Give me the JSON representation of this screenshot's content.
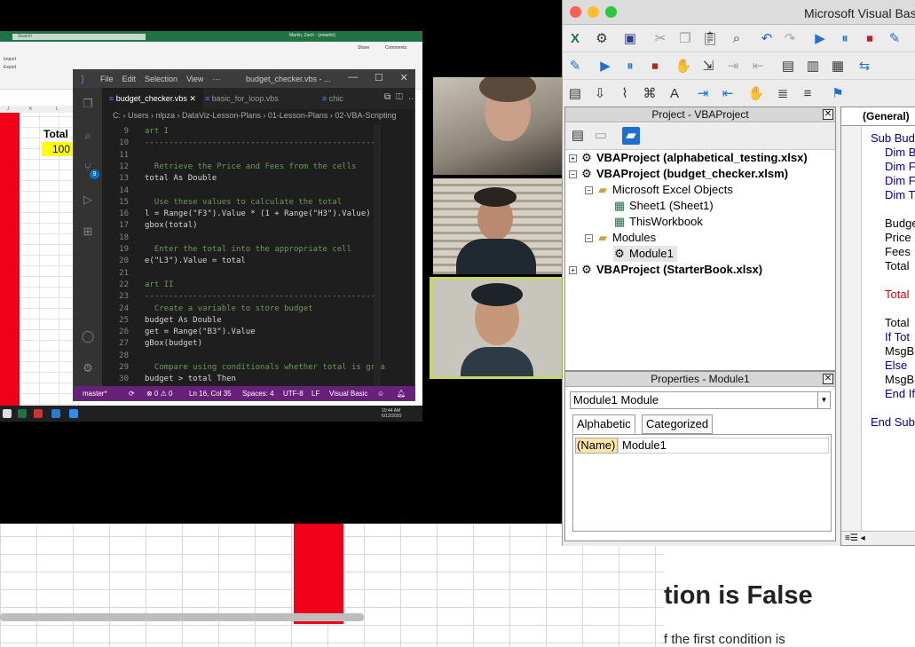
{
  "doc": {
    "heading": "tion is False",
    "line": "f the first condition is"
  },
  "share": {
    "search_placeholder": "Search",
    "user": "Martin, Zach · (zmartin)",
    "share_label": "Share",
    "comments_label": "Comments",
    "import_label": "Import",
    "export_label": "Export",
    "col_j": "J",
    "col_k": "K",
    "col_l": "L",
    "total_label": "Total",
    "total_value": "100",
    "clock_time": "10:44 AM",
    "clock_date": "6/12/2020"
  },
  "vscode": {
    "menu": [
      "File",
      "Edit",
      "Selection",
      "View",
      "···"
    ],
    "window_title": "budget_checker.vbs - ...",
    "tabs": [
      "budget_checker.vbs",
      "basic_for_loop.vbs",
      "chic"
    ],
    "breadcrumb": "C: › Users › nlpza › DataViz-Lesson-Plans › 01-Lesson-Plans › 02-VBA-Scripting",
    "lines": [
      {
        "n": "9",
        "t": "art I"
      },
      {
        "n": "10",
        "t": "------------------------------------------------"
      },
      {
        "n": "11",
        "t": ""
      },
      {
        "n": "12",
        "t": "  Retrieve the Price and Fees from the cells"
      },
      {
        "n": "13",
        "t": "total As Double"
      },
      {
        "n": "14",
        "t": ""
      },
      {
        "n": "15",
        "t": "  Use these values to calculate the total"
      },
      {
        "n": "16",
        "t": "l = Range(\"F3\").Value * (1 + Range(\"H3\").Value)"
      },
      {
        "n": "17",
        "t": "gbox(total)"
      },
      {
        "n": "18",
        "t": ""
      },
      {
        "n": "19",
        "t": "  Enter the total into the appropriate cell"
      },
      {
        "n": "20",
        "t": "e(\"L3\").Value = total"
      },
      {
        "n": "21",
        "t": ""
      },
      {
        "n": "22",
        "t": "art II"
      },
      {
        "n": "23",
        "t": "------------------------------------------------"
      },
      {
        "n": "24",
        "t": "  Create a variable to store budget"
      },
      {
        "n": "25",
        "t": "budget As Double"
      },
      {
        "n": "26",
        "t": "get = Range(\"B3\").Value"
      },
      {
        "n": "27",
        "t": "gBox(budget)"
      },
      {
        "n": "28",
        "t": ""
      },
      {
        "n": "29",
        "t": "  Compare using conditionals whether total is grea"
      },
      {
        "n": "30",
        "t": "budget > total Then"
      }
    ],
    "status": {
      "branch": "master*",
      "problems": "⊗ 0 ⚠ 0",
      "position": "Ln 16, Col 35",
      "spaces": "Spaces: 4",
      "encoding": "UTF-8",
      "eol": "LF",
      "language": "Visual Basic"
    },
    "badge_count": "9"
  },
  "vba": {
    "title": "Microsoft Visual Basi",
    "project_title": "Project - VBAProject",
    "tree": [
      {
        "label": "VBAProject (alphabetical_testing.xlsx)",
        "bold": true
      },
      {
        "label": "VBAProject (budget_checker.xlsm)",
        "bold": true
      },
      {
        "label": "Microsoft Excel Objects",
        "bold": false
      },
      {
        "label": "Sheet1 (Sheet1)",
        "bold": false
      },
      {
        "label": "ThisWorkbook",
        "bold": false
      },
      {
        "label": "Modules",
        "bold": false
      },
      {
        "label": "Module1",
        "bold": false
      },
      {
        "label": "VBAProject (StarterBook.xlsx)",
        "bold": true
      }
    ],
    "properties_title": "Properties - Module1",
    "props_combo": "Module1 Module",
    "tab_alphabetic": "Alphabetic",
    "tab_categorized": "Categorized",
    "prop_name_key": "(Name)",
    "prop_name_value": "Module1",
    "code_combo": "(General)",
    "code_lines": [
      {
        "t": "Sub Bud",
        "c": "kw",
        "i": 0
      },
      {
        "t": "Dim B",
        "c": "kw",
        "i": 1
      },
      {
        "t": "Dim F",
        "c": "kw",
        "i": 1
      },
      {
        "t": "Dim F",
        "c": "kw",
        "i": 1
      },
      {
        "t": "Dim T",
        "c": "kw",
        "i": 1
      },
      {
        "t": "",
        "c": "",
        "i": 1
      },
      {
        "t": "Budge",
        "c": "",
        "i": 1
      },
      {
        "t": "Price",
        "c": "",
        "i": 1
      },
      {
        "t": "Fees",
        "c": "",
        "i": 1
      },
      {
        "t": "Total",
        "c": "",
        "i": 1
      },
      {
        "t": "",
        "c": "",
        "i": 1
      },
      {
        "t": "Total",
        "c": "red",
        "i": 1
      },
      {
        "t": "",
        "c": "",
        "i": 1
      },
      {
        "t": "Total",
        "c": "",
        "i": 1
      },
      {
        "t": "If Tot",
        "c": "kw",
        "i": 1
      },
      {
        "t": "MsgB",
        "c": "",
        "i": 1
      },
      {
        "t": "Else",
        "c": "kw",
        "i": 1
      },
      {
        "t": "MsgB",
        "c": "",
        "i": 1
      },
      {
        "t": "End If",
        "c": "kw",
        "i": 1
      },
      {
        "t": "",
        "c": "",
        "i": 0
      },
      {
        "t": "End Sub",
        "c": "kw",
        "i": 0
      }
    ]
  }
}
